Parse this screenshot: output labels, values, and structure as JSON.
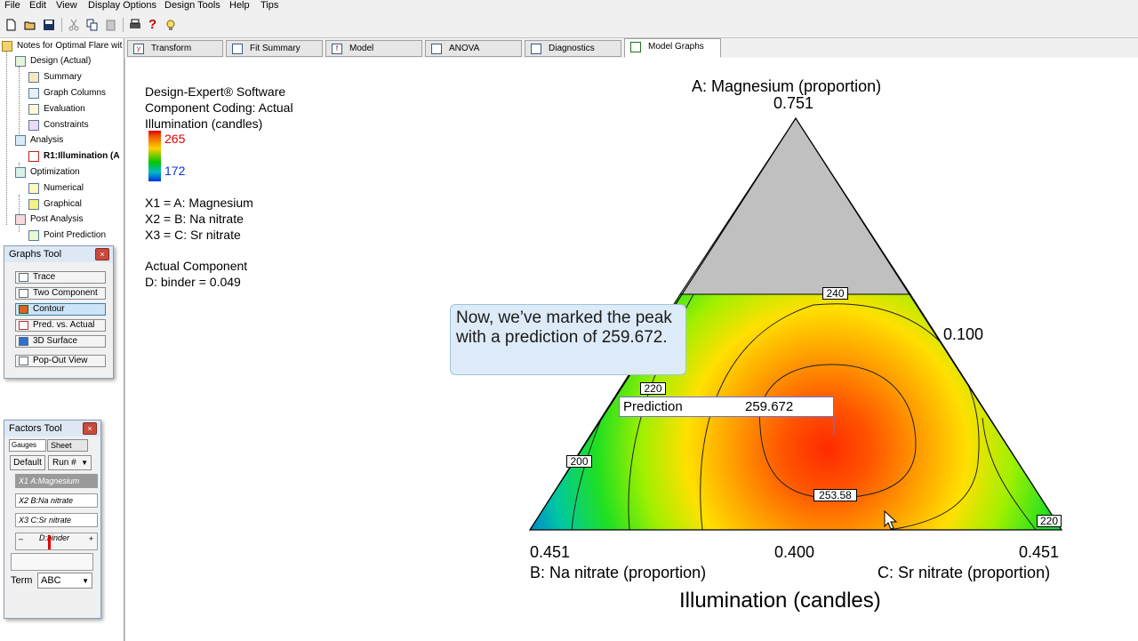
{
  "menu": [
    "File",
    "Edit",
    "View",
    "Display Options",
    "Design Tools",
    "Help",
    "Tips"
  ],
  "toolbar": {
    "icons": [
      "new-file-icon",
      "open-folder-icon",
      "save-icon",
      "cut-icon",
      "copy-icon",
      "paste-icon",
      "print-icon",
      "help-icon",
      "tip-bulb-icon"
    ],
    "help_glyph": "?"
  },
  "tree": {
    "root": "Notes for Optimal Flare wit",
    "items": [
      {
        "label": "Design (Actual)",
        "level": 1
      },
      {
        "label": "Summary",
        "level": 2
      },
      {
        "label": "Graph Columns",
        "level": 2
      },
      {
        "label": "Evaluation",
        "level": 2
      },
      {
        "label": "Constraints",
        "level": 2
      },
      {
        "label": "Analysis",
        "level": 1
      },
      {
        "label": "R1:Illumination (A",
        "level": 2
      },
      {
        "label": "Optimization",
        "level": 1
      },
      {
        "label": "Numerical",
        "level": 2
      },
      {
        "label": "Graphical",
        "level": 2
      },
      {
        "label": "Post Analysis",
        "level": 1
      },
      {
        "label": "Point Prediction",
        "level": 2
      }
    ]
  },
  "graphs_tool": {
    "title": "Graphs Tool",
    "close": "×",
    "buttons": [
      "Trace",
      "Two Component",
      "Contour",
      "Pred. vs. Actual",
      "3D Surface",
      "Pop-Out View"
    ],
    "selected": "Contour"
  },
  "factors_tool": {
    "title": "Factors Tool",
    "close": "×",
    "tab_gauges": "Gauges",
    "tab_sheet": "Sheet",
    "default_label": "Default",
    "run_label": "Run #",
    "factors": [
      {
        "code": "X1",
        "name": "A:Magnesium",
        "selected": true
      },
      {
        "code": "X2",
        "name": "B:Na nitrate",
        "selected": false
      },
      {
        "code": "X3",
        "name": "C:Sr nitrate",
        "selected": false
      }
    ],
    "binder": {
      "minus": "–",
      "name": "D:binder",
      "plus": "+"
    },
    "term_label": "Term",
    "term_value": "ABC"
  },
  "tabs": [
    {
      "label": "Transform",
      "icon": "transform-icon"
    },
    {
      "label": "Fit Summary",
      "icon": "fit-summary-icon"
    },
    {
      "label": "Model",
      "icon": "model-icon"
    },
    {
      "label": "ANOVA",
      "icon": "anova-icon"
    },
    {
      "label": "Diagnostics",
      "icon": "diagnostics-icon"
    },
    {
      "label": "Model Graphs",
      "icon": "model-graphs-icon",
      "active": true
    }
  ],
  "legend": {
    "software": "Design-Expert® Software",
    "coding": "Component Coding: Actual",
    "response": "Illumination (candles)",
    "max": "265",
    "min": "172",
    "x1": "X1 = A: Magnesium",
    "x2": "X2 = B: Na nitrate",
    "x3": "X3 = C: Sr nitrate",
    "actual_title": "Actual Component",
    "actual_value": "D: binder = 0.049"
  },
  "chart_data": {
    "type": "contour",
    "title": "Illumination (candles)",
    "vertex_top": {
      "label": "A: Magnesium (proportion)",
      "value": "0.751"
    },
    "vertex_left": {
      "label": "B: Na nitrate (proportion)",
      "value": "0.451"
    },
    "vertex_right": {
      "label": "C: Sr nitrate (proportion)",
      "value": "0.451"
    },
    "edge_bottom_mid": "0.400",
    "edge_right_mid": "0.100",
    "color_range": [
      172,
      265
    ],
    "contour_levels": [
      "200",
      "220",
      "240",
      "253.58",
      "220"
    ],
    "prediction": {
      "label": "Prediction",
      "value": "259.672"
    }
  },
  "callout": "Now, we’ve marked the peak with a prediction of 259.672."
}
